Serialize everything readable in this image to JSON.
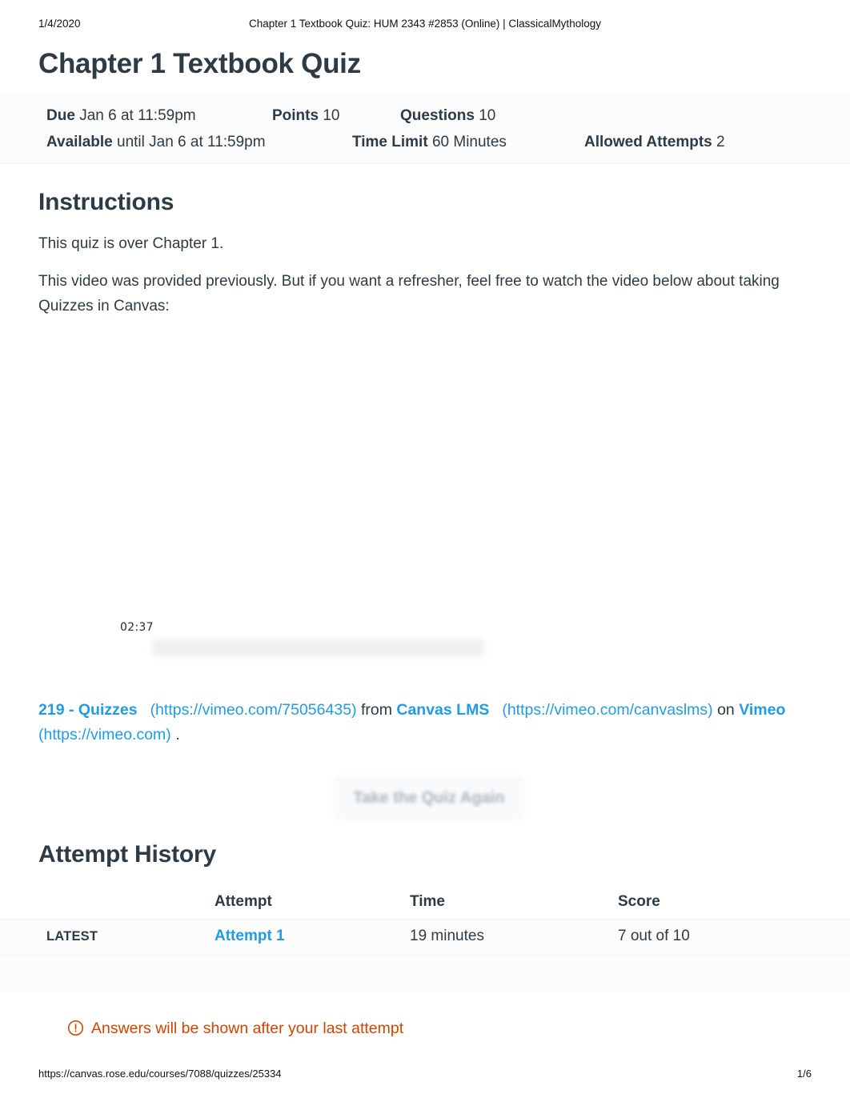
{
  "print": {
    "date": "1/4/2020",
    "doc_title": "Chapter 1 Textbook Quiz: HUM 2343 #2853 (Online) | ClassicalMythology",
    "footer_url": "https://canvas.rose.edu/courses/7088/quizzes/25334",
    "page_number": "1/6"
  },
  "quiz": {
    "title": "Chapter 1 Textbook Quiz",
    "details": {
      "due_label": "Due",
      "due_value": "Jan 6 at 11:59pm",
      "points_label": "Points",
      "points_value": "10",
      "questions_label": "Questions",
      "questions_value": "10",
      "available_label": "Available",
      "available_value": "until Jan 6 at 11:59pm",
      "time_limit_label": "Time Limit",
      "time_limit_value": "60 Minutes",
      "allowed_attempts_label": "Allowed Attempts",
      "allowed_attempts_value": "2"
    }
  },
  "instructions": {
    "heading": "Instructions",
    "paragraph_1": "This quiz is over Chapter 1.",
    "paragraph_2": "This video was provided previously. But if you want a refresher, feel free to watch the video below about taking Quizzes in Canvas:"
  },
  "video": {
    "timestamp": "02:37"
  },
  "credit": {
    "video_link_text": "219 - Quizzes",
    "video_link_url": "(https://vimeo.com/75056435)",
    "from_text": "from",
    "channel_link_text": "Canvas LMS",
    "channel_link_url": "(https://vimeo.com/canvaslms)",
    "on_text": "on",
    "site_link_text": "Vimeo",
    "site_link_url": "(https://vimeo.com)",
    "period": "."
  },
  "actions": {
    "retake_label": "Take the Quiz Again"
  },
  "attempt_history": {
    "heading": "Attempt History",
    "columns": {
      "kept": "",
      "attempt": "Attempt",
      "time": "Time",
      "score": "Score"
    },
    "rows": [
      {
        "kept": "LATEST",
        "attempt": "Attempt 1",
        "time": "19 minutes",
        "score": "7 out of 10"
      }
    ]
  },
  "notice": {
    "icon": "warning-circle-icon",
    "text": "Answers will be shown after your last attempt"
  },
  "colors": {
    "link_blue": "#1f9de4",
    "notice_orange": "#d14400",
    "text_dark": "#2d3b45",
    "band_gray": "#fbfbfc"
  }
}
